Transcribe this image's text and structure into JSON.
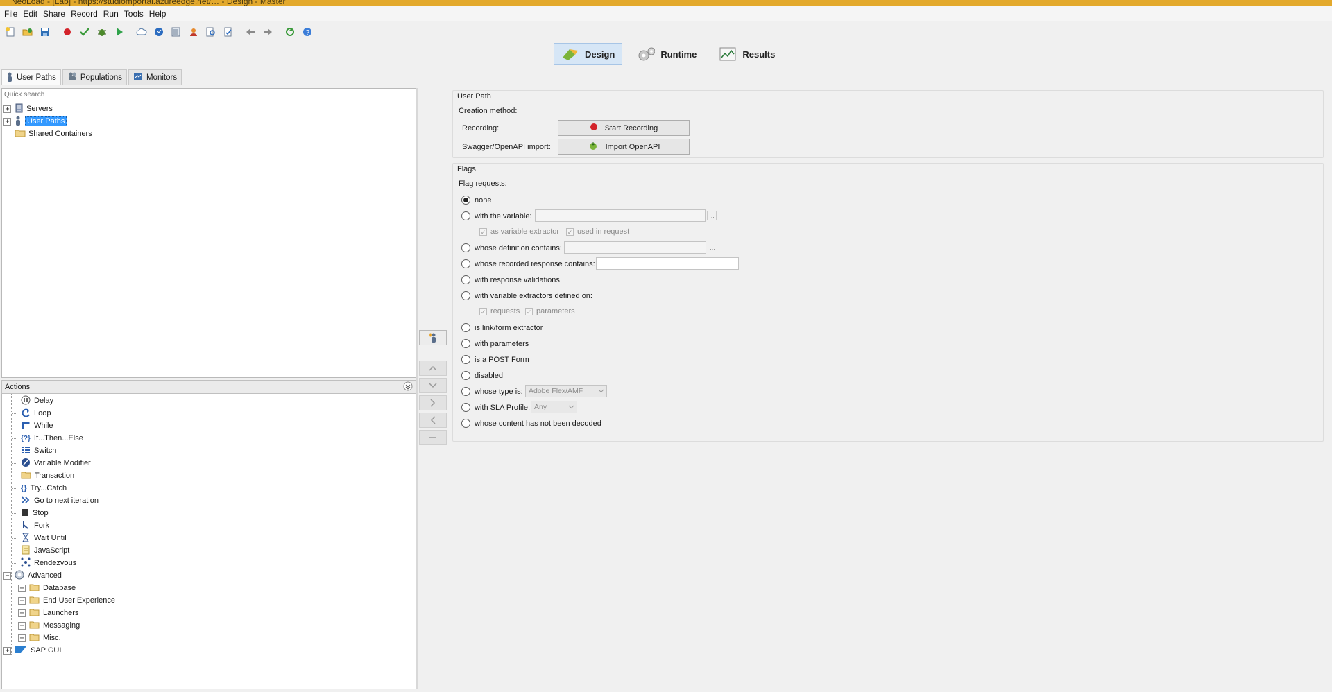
{
  "window": {
    "title": "NeoLoad - [Lab] - https://studiomportal.azureedge.net/… - Design - Master"
  },
  "menu": [
    "File",
    "Edit",
    "Share",
    "Record",
    "Run",
    "Tools",
    "Help"
  ],
  "toolbar": [
    "new-icon",
    "open-icon",
    "save-icon",
    "record-icon",
    "check-icon",
    "debug-icon",
    "run-icon",
    "cloud-icon",
    "globe-icon",
    "export-icon",
    "people-icon",
    "search-doc-icon",
    "wizard-icon",
    "back-icon",
    "forward-icon",
    "sync-icon",
    "help-icon"
  ],
  "modes": {
    "design": "Design",
    "runtime": "Runtime",
    "results": "Results"
  },
  "left_tabs": {
    "user_paths": "User Paths",
    "populations": "Populations",
    "monitors": "Monitors"
  },
  "tree": {
    "search_placeholder": "Quick search",
    "items": {
      "servers": "Servers",
      "user_paths": "User Paths",
      "shared": "Shared Containers"
    }
  },
  "actions": {
    "header": "Actions",
    "items": {
      "delay": "Delay",
      "loop": "Loop",
      "while": "While",
      "ifthen": "If...Then...Else",
      "switch": "Switch",
      "varmod": "Variable Modifier",
      "transaction": "Transaction",
      "trycatch": "Try...Catch",
      "gonext": "Go to next iteration",
      "stop": "Stop",
      "fork": "Fork",
      "waituntil": "Wait Until",
      "javascript": "JavaScript",
      "rendezvous": "Rendezvous",
      "advanced": "Advanced",
      "database": "Database",
      "eue": "End User Experience",
      "launchers": "Launchers",
      "messaging": "Messaging",
      "misc": "Misc.",
      "sapgui": "SAP GUI"
    }
  },
  "user_path": {
    "title": "User Path",
    "creation": "Creation method:",
    "recording_label": "Recording:",
    "recording_btn": "Start Recording",
    "swagger_label": "Swagger/OpenAPI import:",
    "swagger_btn": "Import OpenAPI"
  },
  "flags": {
    "title": "Flags",
    "flag_requests": "Flag requests:",
    "none": "none",
    "with_variable": "with the variable:",
    "as_var_extractor": "as variable extractor",
    "used_in_request": "used in request",
    "whose_def": "whose definition contains:",
    "whose_resp": "whose recorded response contains:",
    "with_resp_val": "with response validations",
    "with_var_ext": "with variable extractors defined on:",
    "requests": "requests",
    "parameters": "parameters",
    "is_link": "is link/form extractor",
    "with_params": "with parameters",
    "is_post": "is a POST Form",
    "disabled": "disabled",
    "whose_type": "whose type is:",
    "type_value": "Adobe Flex/AMF",
    "with_sla": "with SLA Profile:",
    "sla_value": "Any",
    "not_decoded": "whose content has not been decoded"
  },
  "ellipsis": "..."
}
